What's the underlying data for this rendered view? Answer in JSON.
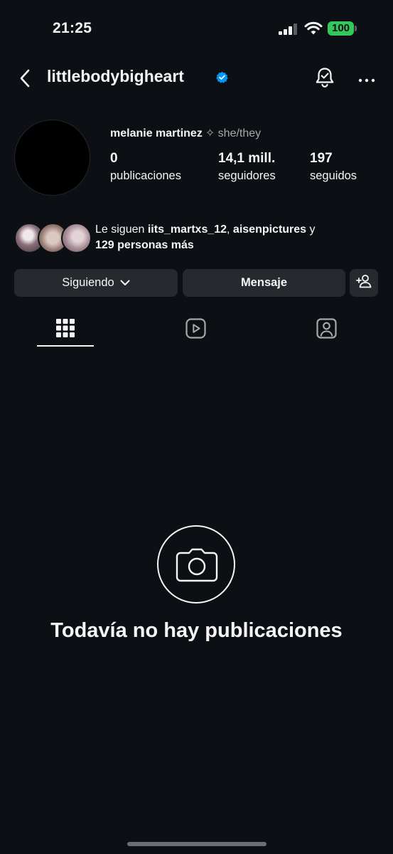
{
  "status_bar": {
    "time": "21:25",
    "battery": "100"
  },
  "header": {
    "username": "littlebodybigheart"
  },
  "profile": {
    "full_name": "melanie martinez",
    "pronouns": "✧ she/they",
    "stats": [
      {
        "value": "0",
        "label": "publicaciones"
      },
      {
        "value": "14,1 mill.",
        "label": "seguidores"
      },
      {
        "value": "197",
        "label": "seguidos"
      }
    ]
  },
  "followed_by": {
    "prefix": "Le siguen ",
    "user1": "iits_martxs_12",
    "sep": ", ",
    "user2": "aisenpictures",
    "joiner": " y",
    "others": "129 personas más"
  },
  "actions": {
    "following_label": "Siguiendo",
    "message_label": "Mensaje"
  },
  "tabs": [
    "grid-icon",
    "reels-icon",
    "tagged-icon"
  ],
  "empty_state": {
    "text": "Todavía no hay publicaciones"
  },
  "colors": {
    "background": "#0c1014",
    "button": "#262a2f",
    "verified": "#0095f6",
    "battery": "#34c759"
  }
}
